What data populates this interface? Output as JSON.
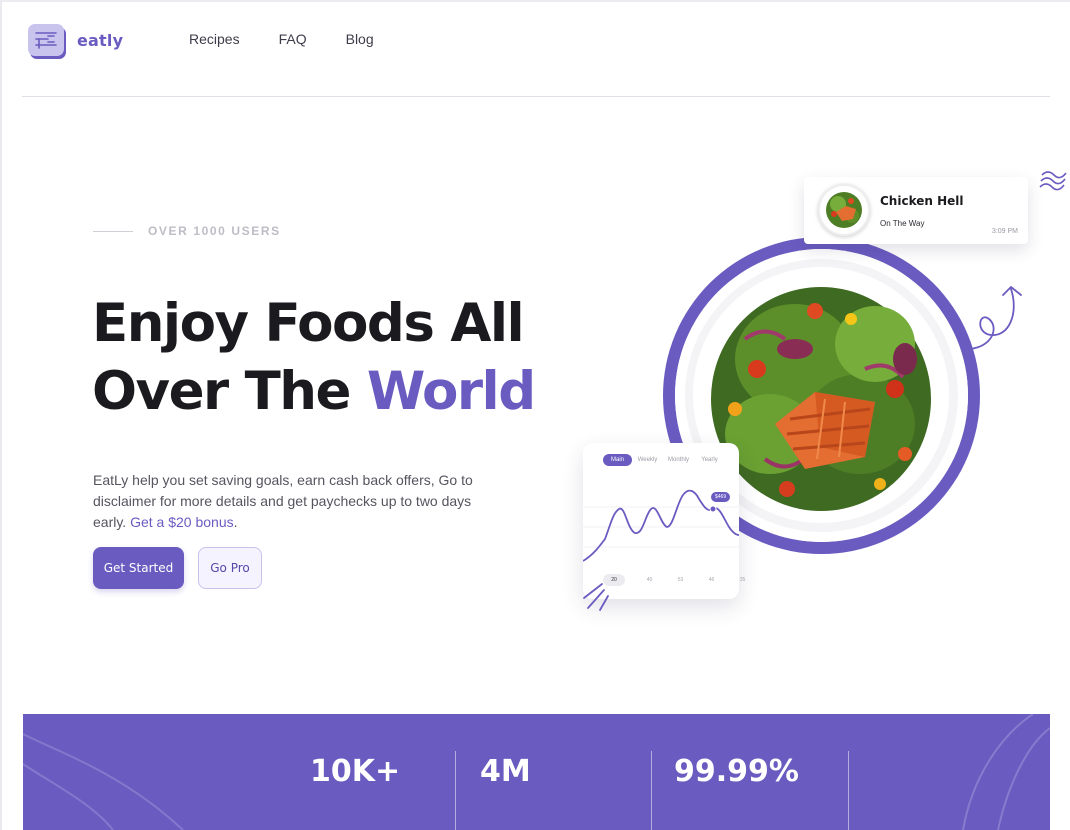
{
  "brand": {
    "name": "eatly",
    "accent": "#6A5BC1"
  },
  "nav": {
    "links": [
      "Recipes",
      "FAQ",
      "Blog"
    ]
  },
  "hero": {
    "eyebrow": "OVER 1000 USERS",
    "headline_line1": "Enjoy Foods All",
    "headline_line2_plain": "Over The ",
    "headline_line2_accent": "World",
    "description": "EatLy help you set saving goals, earn cash back offers, Go to disclaimer for more details and get paychecks up to two days early. ",
    "description_link": "Get a $20 bonus",
    "description_end": ".",
    "primary_button": "Get Started",
    "secondary_button": "Go Pro"
  },
  "notification": {
    "title": "Chicken Hell",
    "status": "On The Way",
    "time": "3:09 PM"
  },
  "chart_card": {
    "tabs": [
      "Main",
      "Weekly",
      "Monthly",
      "Yearly"
    ],
    "active_tab": "Main",
    "tooltip": "$469",
    "x_labels": [
      "20",
      "40",
      "53",
      "46",
      "35"
    ]
  },
  "stats": {
    "items": [
      "10K+",
      "4M",
      "99.99%"
    ]
  }
}
